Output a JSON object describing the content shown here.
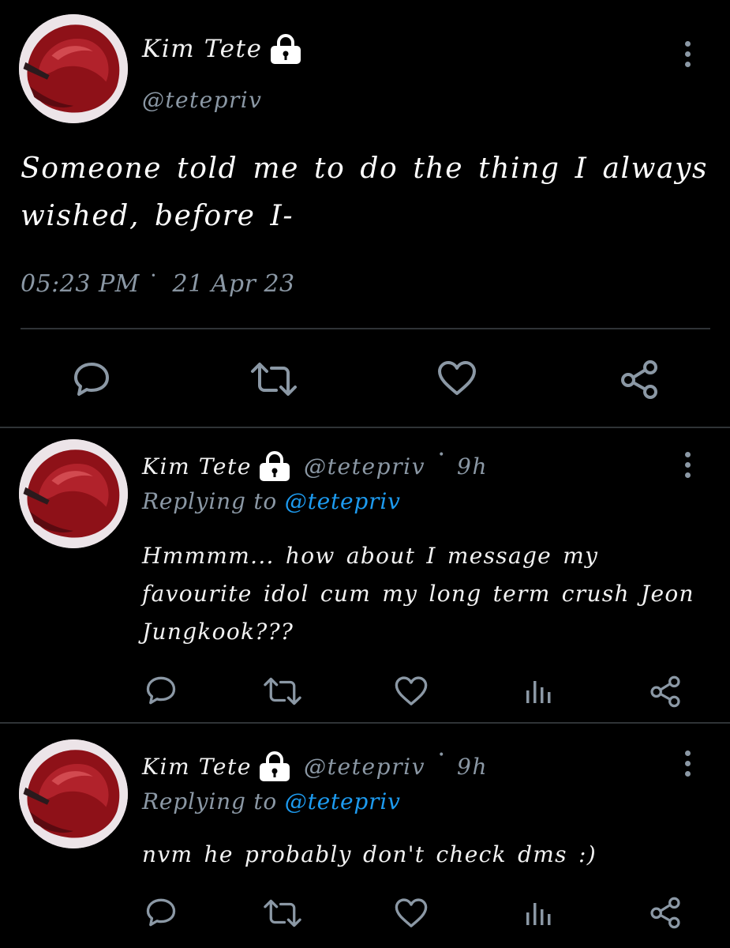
{
  "main_tweet": {
    "name": "Kim Tete",
    "handle": "@tetepriv",
    "text": "Someone told me to do the thing I always wished, before I-",
    "time": "05:23 PM",
    "date": "21 Apr 23",
    "actions": [
      "comment-icon",
      "retweet-icon",
      "heart-icon",
      "share-icon"
    ]
  },
  "replies": [
    {
      "name": "Kim Tete",
      "handle": "@tetepriv",
      "age": "9h",
      "replying_prefix": "Replying to",
      "replying_mention": "@tetepriv",
      "text": "Hmmmm... how about I message my favourite idol cum my long term crush Jeon Jungkook???",
      "actions": [
        "comment-icon",
        "retweet-icon",
        "heart-icon",
        "analytics-icon",
        "share-icon"
      ]
    },
    {
      "name": "Kim Tete",
      "handle": "@tetepriv",
      "age": "9h",
      "replying_prefix": "Replying to",
      "replying_mention": "@tetepriv",
      "text": "nvm he probably don't check dms :)",
      "actions": [
        "comment-icon",
        "retweet-icon",
        "heart-icon",
        "analytics-icon",
        "share-icon"
      ]
    }
  ],
  "colors": {
    "background": "#000000",
    "text": "#f2f2f2",
    "muted": "#8b98a5",
    "mention": "#1d9bf0",
    "divider": "#2f3336",
    "avatar_hair": "#8e1118"
  }
}
